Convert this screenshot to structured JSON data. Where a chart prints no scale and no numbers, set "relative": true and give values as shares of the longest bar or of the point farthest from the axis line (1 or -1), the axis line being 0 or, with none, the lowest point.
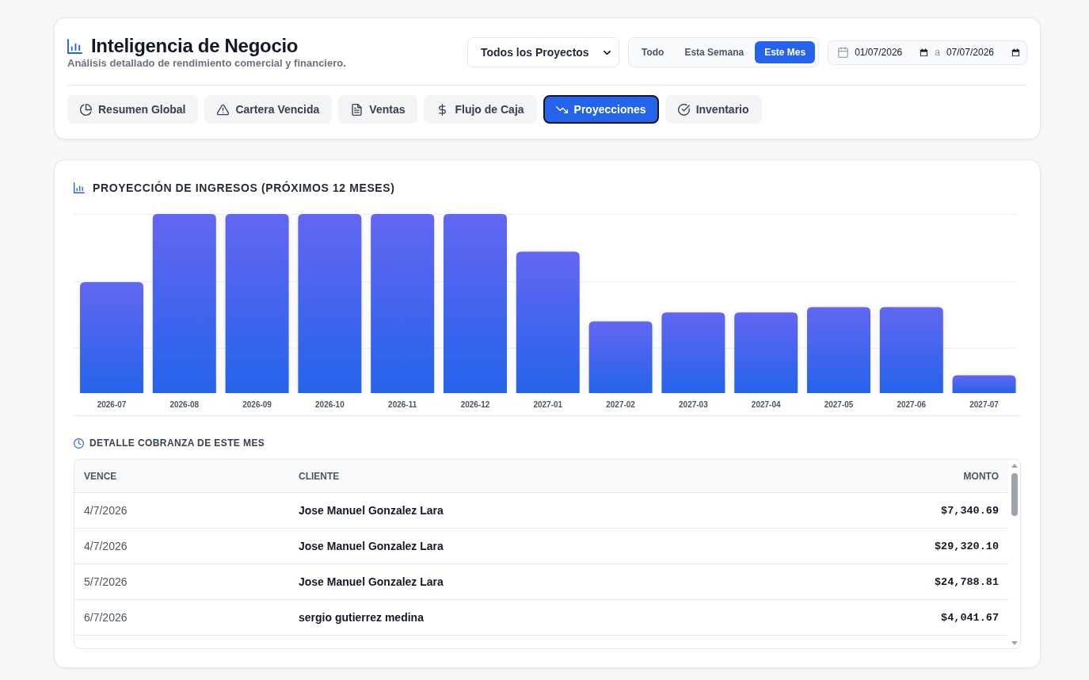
{
  "header": {
    "title": "Inteligencia de Negocio",
    "subtitle": "Análisis detallado de rendimiento comercial y financiero."
  },
  "project_filter": {
    "value": "Todos los Proyectos"
  },
  "period_filter": [
    {
      "label": "Todo",
      "selected": false
    },
    {
      "label": "Esta Semana",
      "selected": false
    },
    {
      "label": "Este Mes",
      "selected": true
    }
  ],
  "date_range": {
    "from": "01/07/2026",
    "separator": "a",
    "to": "07/07/2026"
  },
  "tabs": [
    {
      "label": "Resumen Global",
      "selected": false
    },
    {
      "label": "Cartera Vencida",
      "selected": false
    },
    {
      "label": "Ventas",
      "selected": false
    },
    {
      "label": "Flujo de Caja",
      "selected": false
    },
    {
      "label": "Proyecciones",
      "selected": true
    },
    {
      "label": "Inventario",
      "selected": false
    }
  ],
  "revenue_projection": {
    "chart_data": {
      "type": "bar",
      "title": "PROYECCIÓN DE INGRESOS (PRÓXIMOS 12 MESES)",
      "categories": [
        "2026-07",
        "2026-08",
        "2026-09",
        "2026-10",
        "2026-11",
        "2026-12",
        "2027-01",
        "2027-02",
        "2027-03",
        "2027-04",
        "2027-05",
        "2027-06",
        "2027-07"
      ],
      "values": [
        0.62,
        1,
        1,
        1,
        1,
        1,
        0.79,
        0.4,
        0.45,
        0.45,
        0.48,
        0.48,
        0.1
      ],
      "relative": true
    }
  },
  "collections": {
    "title": "DETALLE COBRANZA DE ESTE MES",
    "columns": [
      "VENCE",
      "CLIENTE",
      "MONTO"
    ],
    "rows": [
      {
        "due": "4/7/2026",
        "client": "Jose Manuel Gonzalez Lara",
        "amount": "$7,340.69"
      },
      {
        "due": "4/7/2026",
        "client": "Jose Manuel Gonzalez Lara",
        "amount": "$29,320.10"
      },
      {
        "due": "5/7/2026",
        "client": "Jose Manuel Gonzalez Lara",
        "amount": "$24,788.81"
      },
      {
        "due": "6/7/2026",
        "client": "sergio gutierrez medina",
        "amount": "$4,041.67"
      }
    ]
  }
}
